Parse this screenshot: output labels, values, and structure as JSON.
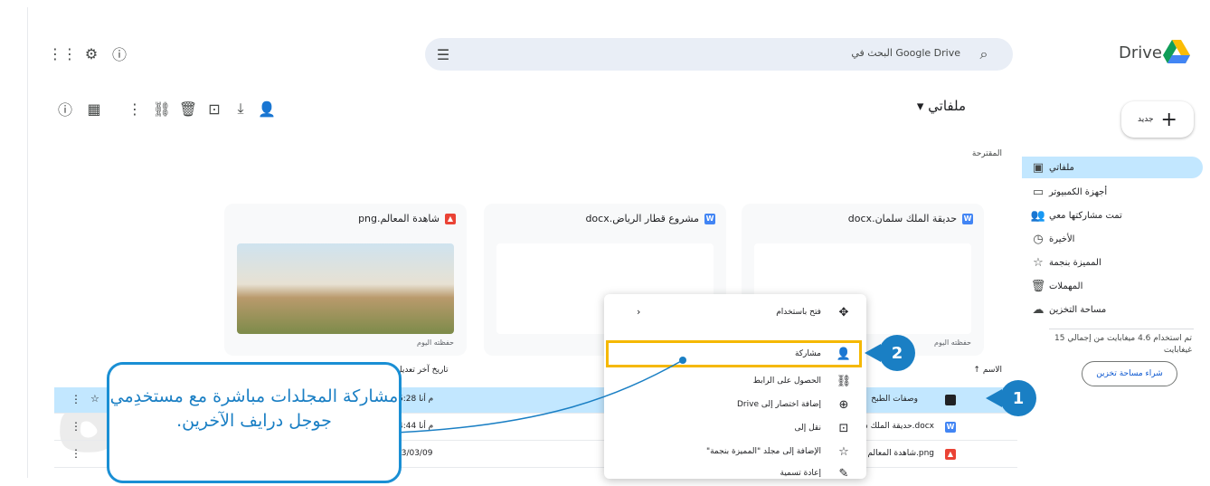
{
  "header": {
    "app_name": "Drive",
    "search_placeholder": "البحث في Google Drive"
  },
  "sidebar": {
    "new_label": "جديد",
    "items": [
      {
        "label": "ملفاتي",
        "icon": "drive-icon"
      },
      {
        "label": "أجهزة الكمبيوتر",
        "icon": "computer-icon"
      },
      {
        "label": "تمت مشاركتها معي",
        "icon": "people-icon"
      },
      {
        "label": "الأخيرة",
        "icon": "clock-icon"
      },
      {
        "label": "المميزة بنجمة",
        "icon": "star-icon"
      },
      {
        "label": "المهملات",
        "icon": "trash-icon"
      },
      {
        "label": "مساحة التخزين",
        "icon": "cloud-icon"
      }
    ],
    "storage_text": "تم استخدام 4.6 ميغابايت من إجمالي 15 غيغابايت",
    "buy_storage_label": "شراء مساحة تخزين"
  },
  "main": {
    "title": "ملفاتي",
    "suggested_label": "المقترحة",
    "cards": [
      {
        "name": "حديقة الملك سلمان.docx",
        "type": "W",
        "meta": "حفظته اليوم"
      },
      {
        "name": "مشروع قطار الرياض.docx",
        "type": "W",
        "meta": ""
      },
      {
        "name": "شاهدة المعالم.png",
        "type": "▲",
        "meta": "حفظته اليوم"
      }
    ],
    "table": {
      "col_name": "الاسم",
      "col_modified": "تاريخ آخر تعديل",
      "rows": [
        {
          "name": "وصفات الطبخ",
          "modified": "5:28 م أنا"
        },
        {
          "name": "حديقة الملك سلمان.docx",
          "modified": "4:44 م أنا"
        },
        {
          "name": "شاهدة المعالم.png",
          "modified": "23/03/09"
        }
      ]
    }
  },
  "context_menu": {
    "items": [
      {
        "label": "فتح باستخدام",
        "icon": "open-with-icon"
      },
      {
        "label": "مشاركة",
        "icon": "share-icon"
      },
      {
        "label": "الحصول على الرابط",
        "icon": "link-icon"
      },
      {
        "label": "إضافة اختصار إلى Drive",
        "icon": "shortcut-icon"
      },
      {
        "label": "نقل إلى",
        "icon": "move-icon"
      },
      {
        "label": "الإضافة إلى مجلد \"المميزة بنجمة\"",
        "icon": "star-icon"
      },
      {
        "label": "إعادة تسمية",
        "icon": "edit-icon"
      }
    ]
  },
  "annotations": {
    "callout_text": "مشاركة المجلدات مباشرة مع مستخدِمي جوجل درايف الآخرين.",
    "badge_1": "1",
    "badge_2": "2"
  },
  "colors": {
    "accent": "#1a7fc4",
    "highlight": "#f5b800",
    "selected_bg": "#c2e7ff"
  }
}
